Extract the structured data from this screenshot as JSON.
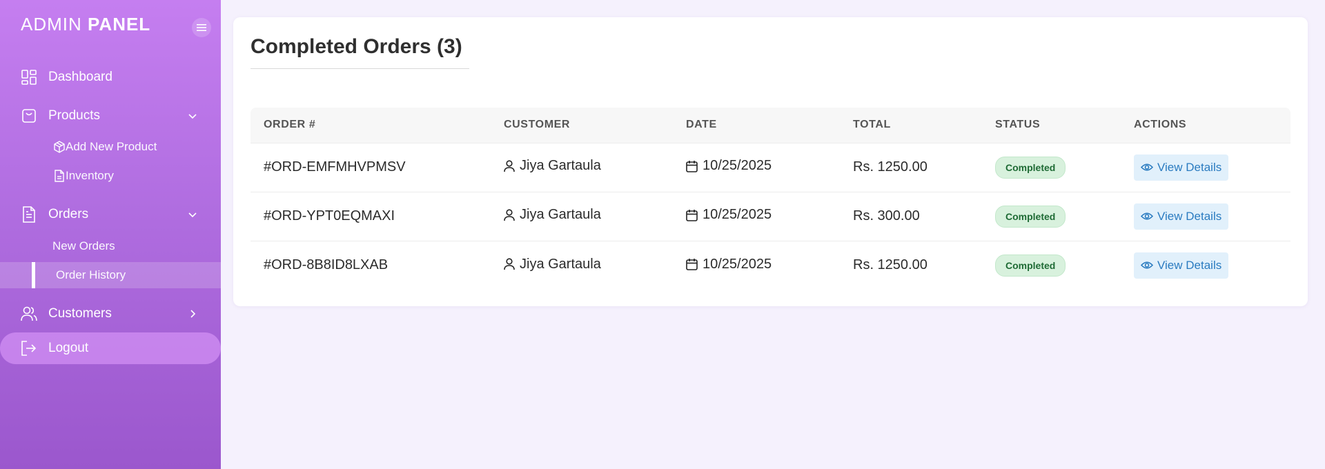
{
  "brand": {
    "light": "ADMIN ",
    "bold": "PANEL"
  },
  "sidebar": {
    "dashboard": "Dashboard",
    "products": "Products",
    "add_new_product": "Add New Product",
    "inventory": "Inventory",
    "orders": "Orders",
    "new_orders": "New Orders",
    "order_history": "Order History",
    "customers": "Customers",
    "logout": "Logout"
  },
  "main": {
    "title": "Completed Orders (3)",
    "columns": [
      "ORDER #",
      "CUSTOMER",
      "DATE",
      "TOTAL",
      "STATUS",
      "ACTIONS"
    ],
    "rows": [
      {
        "order": "#ORD-EMFMHVPMSV",
        "customer": "Jiya Gartaula",
        "date": "10/25/2025",
        "total": "Rs. 1250.00",
        "status": "Completed",
        "action": "View Details"
      },
      {
        "order": "#ORD-YPT0EQMAXI",
        "customer": "Jiya Gartaula",
        "date": "10/25/2025",
        "total": "Rs. 300.00",
        "status": "Completed",
        "action": "View Details"
      },
      {
        "order": "#ORD-8B8ID8LXAB",
        "customer": "Jiya Gartaula",
        "date": "10/25/2025",
        "total": "Rs. 1250.00",
        "status": "Completed",
        "action": "View Details"
      }
    ]
  },
  "icons": {
    "menu": "hamburger-icon",
    "dashboard": "grid-icon",
    "products": "shopping-bag-icon",
    "add_product": "package-icon",
    "inventory": "file-icon",
    "orders": "document-icon",
    "customers": "users-icon",
    "logout": "logout-icon",
    "customer_cell": "user-icon",
    "date_cell": "calendar-icon",
    "view": "eye-icon"
  },
  "colors": {
    "sidebar_top": "#c57ef0",
    "sidebar_bottom": "#9b57cd",
    "status_bg": "#d8f1dd",
    "status_text": "#1f6b35",
    "action_bg": "#e1f0fb",
    "action_text": "#2a7bc0"
  }
}
